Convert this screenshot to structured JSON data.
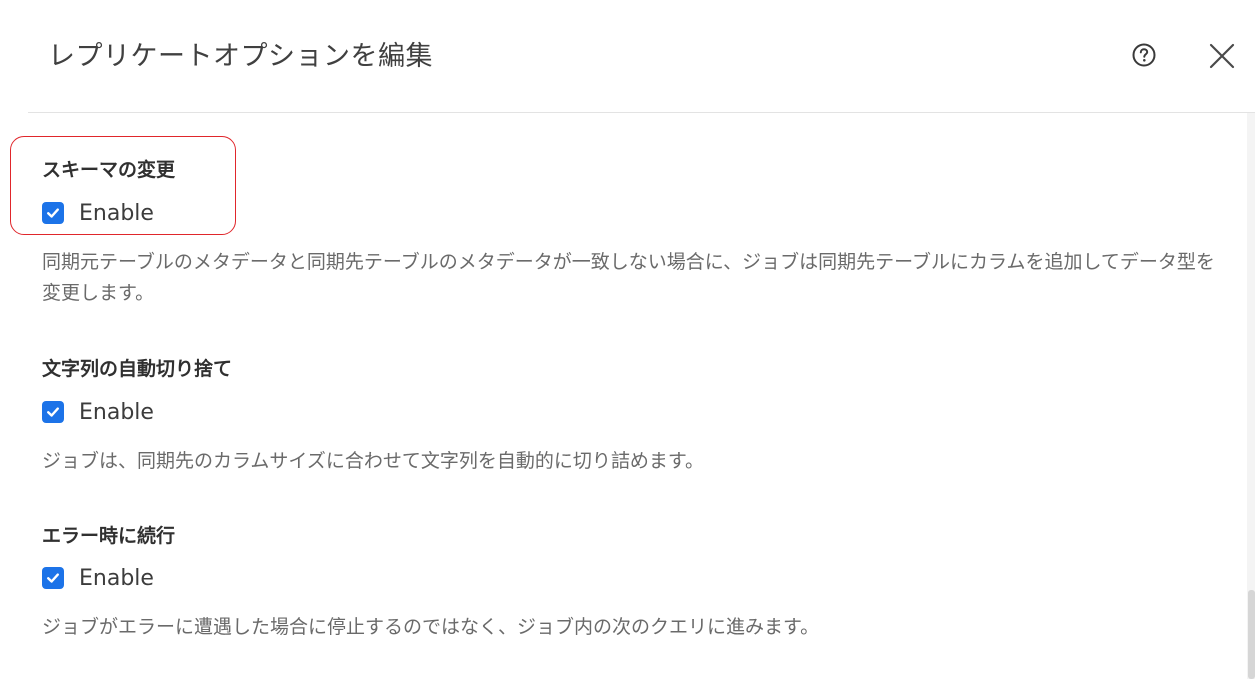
{
  "dialog": {
    "title": "レプリケートオプションを編集"
  },
  "sections": [
    {
      "title": "スキーマの変更",
      "option_label": "Enable",
      "checked": true,
      "description": "同期元テーブルのメタデータと同期先テーブルのメタデータが一致しない場合に、ジョブは同期先テーブルにカラムを追加してデータ型を変更します。"
    },
    {
      "title": "文字列の自動切り捨て",
      "option_label": "Enable",
      "checked": true,
      "description": "ジョブは、同期先のカラムサイズに合わせて文字列を自動的に切り詰めます。"
    },
    {
      "title": "エラー時に続行",
      "option_label": "Enable",
      "checked": true,
      "description": "ジョブがエラーに遭遇した場合に停止するのではなく、ジョブ内の次のクエリに進みます。"
    }
  ],
  "colors": {
    "checkbox": "#1c73e8",
    "highlight": "#e0262b"
  },
  "icons": {
    "help": "help-circle-icon",
    "close": "close-icon",
    "check": "check-icon"
  }
}
